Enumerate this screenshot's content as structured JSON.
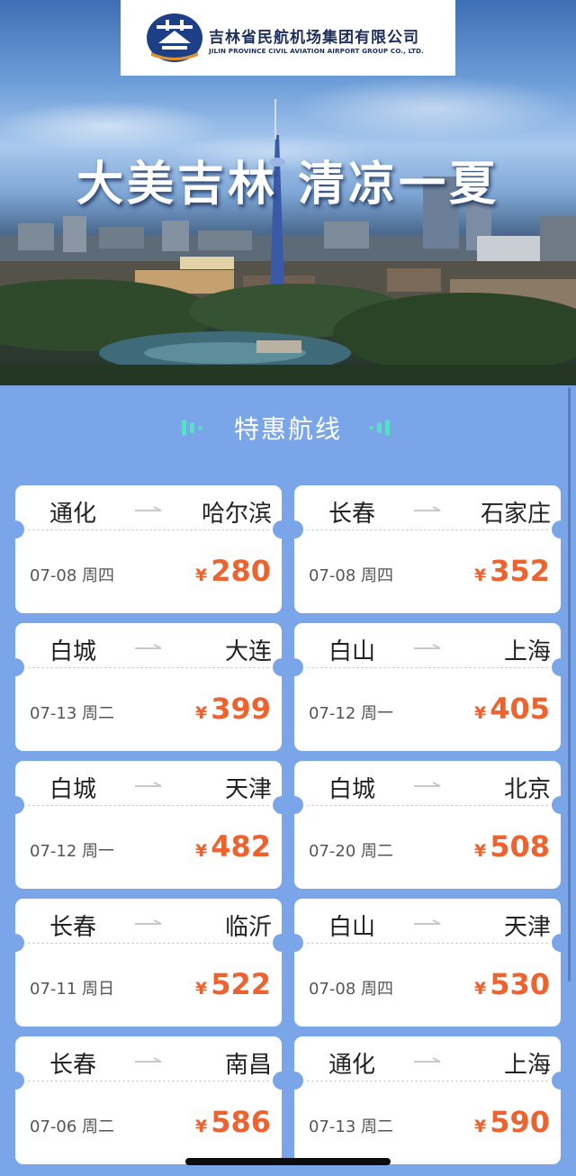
{
  "header": {
    "company_cn": "吉林省民航机场集团有限公司",
    "company_en": "JILIN PROVINCE CIVIL AVIATION AIRPORT GROUP CO., LTD.",
    "slogan": "大美吉林  清凉一夏"
  },
  "section": {
    "title": "特惠航线"
  },
  "currency_symbol": "¥",
  "routes": [
    {
      "from": "通化",
      "to": "哈尔滨",
      "date": "07-08 周四",
      "price": "280"
    },
    {
      "from": "长春",
      "to": "石家庄",
      "date": "07-08 周四",
      "price": "352"
    },
    {
      "from": "白城",
      "to": "大连",
      "date": "07-13 周二",
      "price": "399"
    },
    {
      "from": "白山",
      "to": "上海",
      "date": "07-12 周一",
      "price": "405"
    },
    {
      "from": "白城",
      "to": "天津",
      "date": "07-12 周一",
      "price": "482"
    },
    {
      "from": "白城",
      "to": "北京",
      "date": "07-20 周二",
      "price": "508"
    },
    {
      "from": "长春",
      "to": "临沂",
      "date": "07-11 周日",
      "price": "522"
    },
    {
      "from": "白山",
      "to": "天津",
      "date": "07-08 周四",
      "price": "530"
    },
    {
      "from": "长春",
      "to": "南昌",
      "date": "07-06 周二",
      "price": "586"
    },
    {
      "from": "通化",
      "to": "上海",
      "date": "07-13 周二",
      "price": "590"
    }
  ],
  "colors": {
    "page_background": "#7aa5e9",
    "price": "#ec6330",
    "card": "#ffffff",
    "accent_deco": "#57e0c8"
  }
}
